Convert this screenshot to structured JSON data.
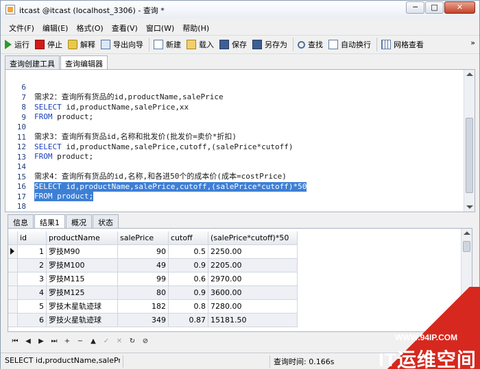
{
  "window": {
    "title": "itcast @itcast (localhost_3306) - 查询 *"
  },
  "menu": [
    "文件(F)",
    "编辑(E)",
    "格式(O)",
    "查看(V)",
    "窗口(W)",
    "帮助(H)"
  ],
  "toolbar": {
    "run": "运行",
    "stop": "停止",
    "explain": "解释",
    "export": "导出向导",
    "new": "新建",
    "load": "载入",
    "save": "保存",
    "save_as": "另存为",
    "find": "查找",
    "wrap": "自动换行",
    "grid_view": "网格查看"
  },
  "editor_tabs": [
    "查询创建工具",
    "查询编辑器"
  ],
  "editor": {
    "lines": [
      {
        "n": "6",
        "text": "需求2：查询所有货品的id,productName,salePrice",
        "keyword": ""
      },
      {
        "n": "7",
        "text": " id,productName,salePrice,xx",
        "keyword": "SELECT"
      },
      {
        "n": "8",
        "text": " product;",
        "keyword": "FROM"
      },
      {
        "n": "9",
        "text": "",
        "keyword": ""
      },
      {
        "n": "10",
        "text": "需求3：查询所有货品id,名称和批发价(批发价=卖价*折扣)",
        "keyword": ""
      },
      {
        "n": "11",
        "text": " id,productName,salePrice,cutoff,(salePrice*cutoff)",
        "keyword": "SELECT"
      },
      {
        "n": "12",
        "text": " product;",
        "keyword": "FROM"
      },
      {
        "n": "13",
        "text": "",
        "keyword": ""
      },
      {
        "n": "14",
        "text": "需求4：查询所有货品的id,名称,和各进50个的成本价(成本=costPrice)",
        "keyword": ""
      },
      {
        "n": "15",
        "text": " id,productName,salePrice,cutoff,(salePrice*cutoff)*50",
        "keyword": "SELECT"
      },
      {
        "n": "16",
        "text": " product;",
        "keyword": "FROM"
      },
      {
        "n": "17",
        "text": "",
        "keyword": ""
      },
      {
        "n": "18",
        "text": "",
        "keyword": ""
      }
    ]
  },
  "result_tabs": [
    "信息",
    "结果1",
    "概况",
    "状态"
  ],
  "grid": {
    "columns": [
      "id",
      "productName",
      "salePrice",
      "cutoff",
      "(salePrice*cutoff)*50"
    ],
    "rows": [
      [
        "1",
        "罗技M90",
        "90",
        "0.5",
        "2250.00"
      ],
      [
        "2",
        "罗技M100",
        "49",
        "0.9",
        "2205.00"
      ],
      [
        "3",
        "罗技M115",
        "99",
        "0.6",
        "2970.00"
      ],
      [
        "4",
        "罗技M125",
        "80",
        "0.9",
        "3600.00"
      ],
      [
        "5",
        "罗技木星轨迹球",
        "182",
        "0.8",
        "7280.00"
      ],
      [
        "6",
        "罗技火星轨迹球",
        "349",
        "0.87",
        "15181.50"
      ]
    ]
  },
  "navigator": [
    "⏮",
    "◀",
    "▶",
    "⏭",
    "+",
    "−",
    "▲",
    "✓",
    "✕",
    "↻",
    "⊘"
  ],
  "status": {
    "sql": "SELECT id,productName,salePr",
    "time": "查询时间: 0.166s"
  },
  "watermark": {
    "url": "WWW.94IP.COM",
    "title": "IT运维空间"
  }
}
